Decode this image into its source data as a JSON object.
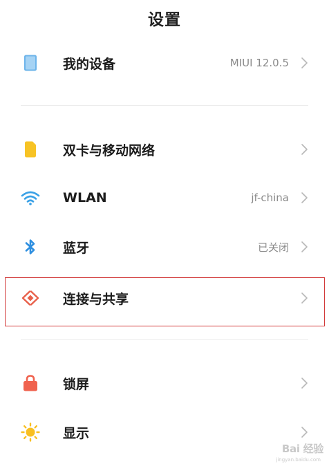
{
  "header": {
    "title": "设置"
  },
  "colors": {
    "device_icon": "#6db4ea",
    "sim_icon": "#f7c325",
    "wlan_icon": "#3aa1e6",
    "bluetooth_icon": "#2e8fe0",
    "share_icon": "#e8604a",
    "lock_icon": "#f0624e",
    "display_icon": "#f8bf22",
    "highlight_border": "#d23a3a"
  },
  "items": [
    {
      "key": "my-device",
      "label": "我的设备",
      "value": "MIUI 12.0.5",
      "icon": "tablet-icon"
    },
    {
      "key": "sim-mobile",
      "label": "双卡与移动网络",
      "value": "",
      "icon": "sim-card-icon"
    },
    {
      "key": "wlan",
      "label": "WLAN",
      "value": "jf-china",
      "icon": "wifi-icon"
    },
    {
      "key": "bluetooth",
      "label": "蓝牙",
      "value": "已关闭",
      "icon": "bluetooth-icon"
    },
    {
      "key": "connection-share",
      "label": "连接与共享",
      "value": "",
      "icon": "share-connect-icon"
    },
    {
      "key": "lock-screen",
      "label": "锁屏",
      "value": "",
      "icon": "lock-icon"
    },
    {
      "key": "display",
      "label": "显示",
      "value": "",
      "icon": "sun-icon"
    }
  ],
  "watermark": {
    "text": "Bai 经验",
    "url": "jingyan.baidu.com"
  }
}
